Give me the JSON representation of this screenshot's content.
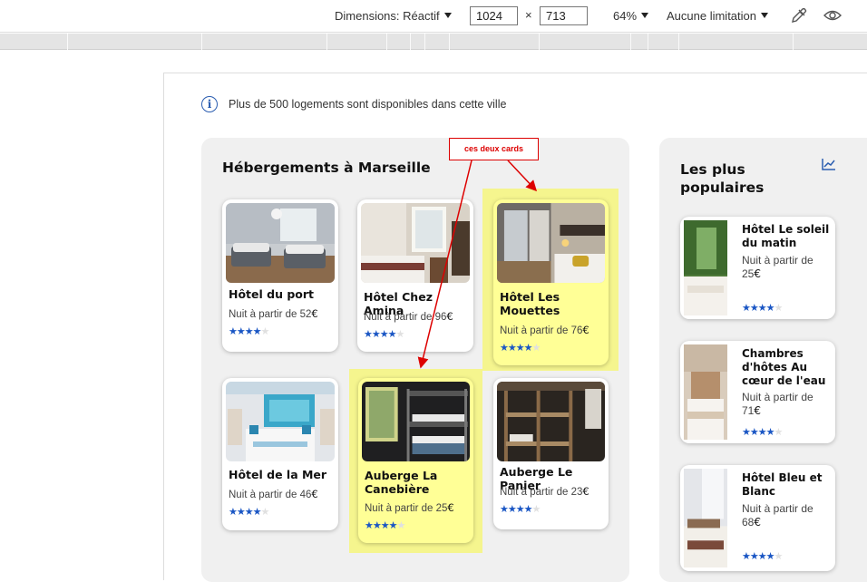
{
  "devtools": {
    "dimensions_label": "Dimensions: Réactif",
    "width_value": "1024",
    "times": "×",
    "height_value": "713",
    "zoom": "64%",
    "throttle": "Aucune limitation",
    "icons": [
      "caret-down-icon",
      "eyedropper-icon",
      "eye-icon"
    ]
  },
  "info": {
    "icon": "i",
    "text": "Plus de 500 logements sont disponibles dans cette ville"
  },
  "main": {
    "title": "Hébergements à Marseille",
    "price_prefix": "Nuit à partir de ",
    "currency": "€",
    "cards": [
      {
        "name": "Hôtel du port",
        "price": "52",
        "stars": 4
      },
      {
        "name": "Hôtel Chez Amina",
        "price": "96",
        "stars": 4
      },
      {
        "name": "Hôtel Les Mouettes",
        "price": "76",
        "stars": 4
      },
      {
        "name": "Hôtel de la Mer",
        "price": "46",
        "stars": 4
      },
      {
        "name": "Auberge La Canebière",
        "price": "25",
        "stars": 4
      },
      {
        "name": "Auberge Le Panier",
        "price": "23",
        "stars": 4
      }
    ]
  },
  "popular": {
    "title": "Les plus populaires",
    "icon": "trending-up-icon",
    "price_prefix": "Nuit à partir de ",
    "currency": "€",
    "cards": [
      {
        "name": "Hôtel Le soleil du matin",
        "price": "25",
        "stars": 4
      },
      {
        "name": "Chambres d'hôtes Au cœur de l'eau",
        "price": "71",
        "stars": 4
      },
      {
        "name": "Hôtel Bleu et Blanc",
        "price": "68",
        "stars": 4
      }
    ]
  },
  "annotation": {
    "label": "ces deux cards",
    "color": "#dd0000",
    "highlight_color": "#f5f58e"
  },
  "colors": {
    "star": "#1a56c4",
    "accent": "#2a5db0",
    "panel": "#f0f0f0"
  }
}
